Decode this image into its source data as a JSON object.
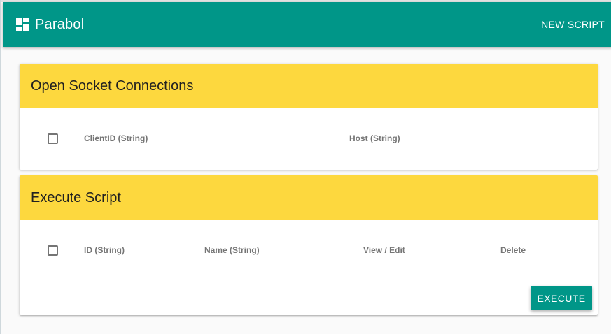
{
  "app": {
    "title": "Parabol",
    "brand_icon": "dashboard-icon",
    "new_script_label": "NEW SCRIPT"
  },
  "colors": {
    "primary": "#009688",
    "header_yellow": "#fdd83e",
    "column_text": "#757575"
  },
  "socket_card": {
    "title": "Open Socket Connections",
    "columns": [
      "ClientID (String)",
      "Host (String)"
    ]
  },
  "script_card": {
    "title": "Execute Script",
    "columns": [
      "ID (String)",
      "Name (String)",
      "View / Edit",
      "Delete"
    ],
    "execute_label": "EXECUTE"
  }
}
